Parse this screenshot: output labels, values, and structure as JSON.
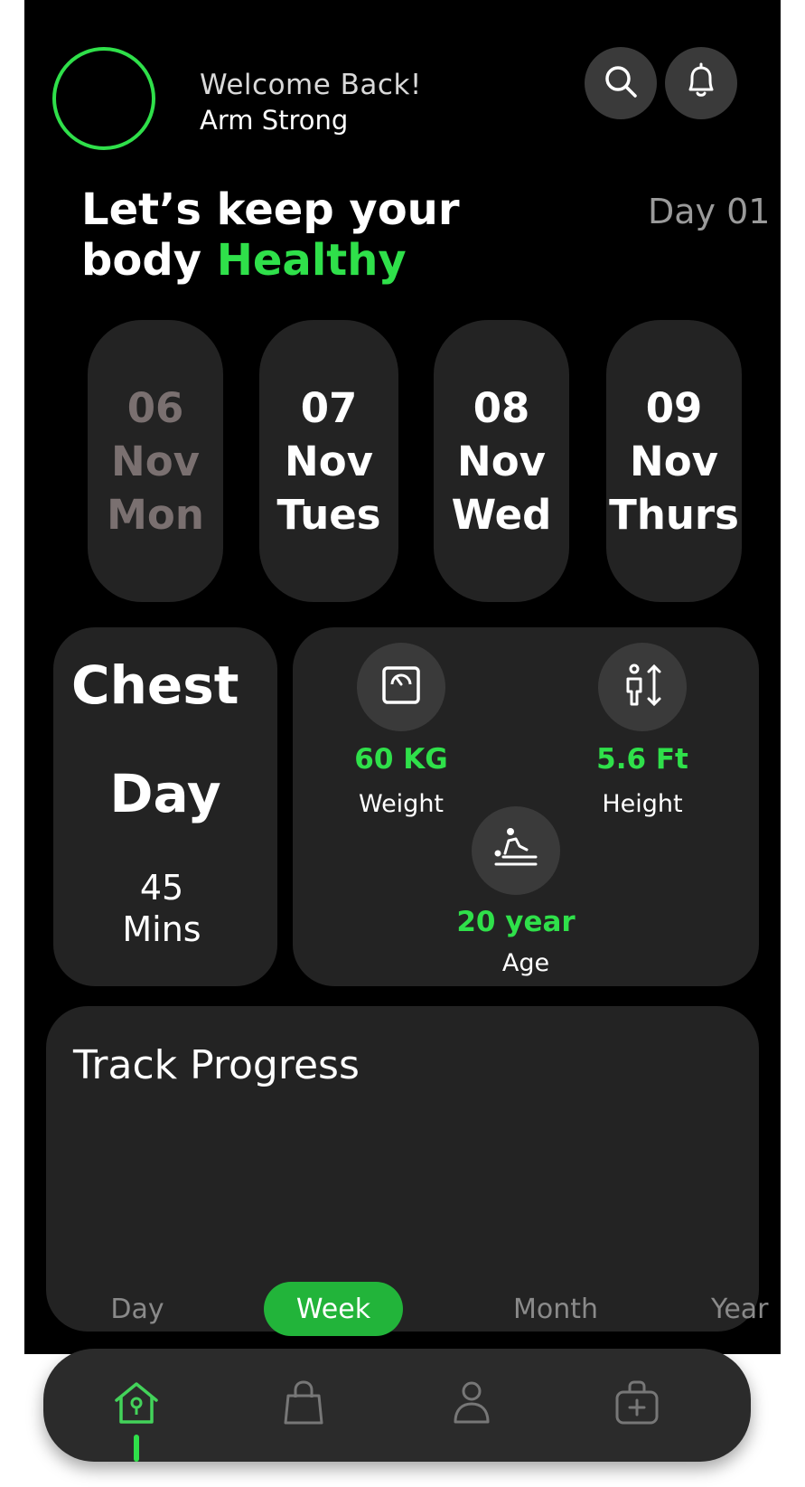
{
  "header": {
    "welcome": "Welcome Back!",
    "user_name": "Arm Strong",
    "search_icon": "search-icon",
    "bell_icon": "bell-icon"
  },
  "hero": {
    "line1": "Let’s keep your",
    "line2_prefix": "body",
    "line2_highlight": "Healthy",
    "day_label": "Day 01"
  },
  "dates": [
    {
      "day": "06",
      "month": "Nov",
      "weekday": "Mon",
      "state": "dimmed"
    },
    {
      "day": "07",
      "month": "Nov",
      "weekday": "Tues",
      "state": "normal"
    },
    {
      "day": "08",
      "month": "Nov",
      "weekday": "Wed",
      "state": "normal"
    },
    {
      "day": "09",
      "month": "Nov",
      "weekday": "Thurs",
      "state": "normal"
    }
  ],
  "workout": {
    "title_line1": "Chest",
    "title_line2": "Day",
    "duration_value": "45",
    "duration_unit": "Mins"
  },
  "stats": {
    "weight": {
      "value": "60 KG",
      "label": "Weight",
      "icon": "scale-icon"
    },
    "height": {
      "value": "5.6 Ft",
      "label": "Height",
      "icon": "height-icon"
    },
    "age": {
      "value": "20 year",
      "label": "Age",
      "icon": "massage-icon"
    }
  },
  "progress": {
    "title": "Track Progress",
    "tabs": [
      "Day",
      "Week",
      "Month",
      "Year"
    ],
    "active_tab": "Week"
  },
  "bottom_nav": {
    "items": [
      "home-icon",
      "shopping-bag-icon",
      "profile-icon",
      "medical-bag-icon"
    ],
    "active": "home-icon"
  },
  "colors": {
    "accent": "#2fe04a",
    "background": "#000000",
    "card": "#232323",
    "icon_circle": "#3a3a3a"
  }
}
